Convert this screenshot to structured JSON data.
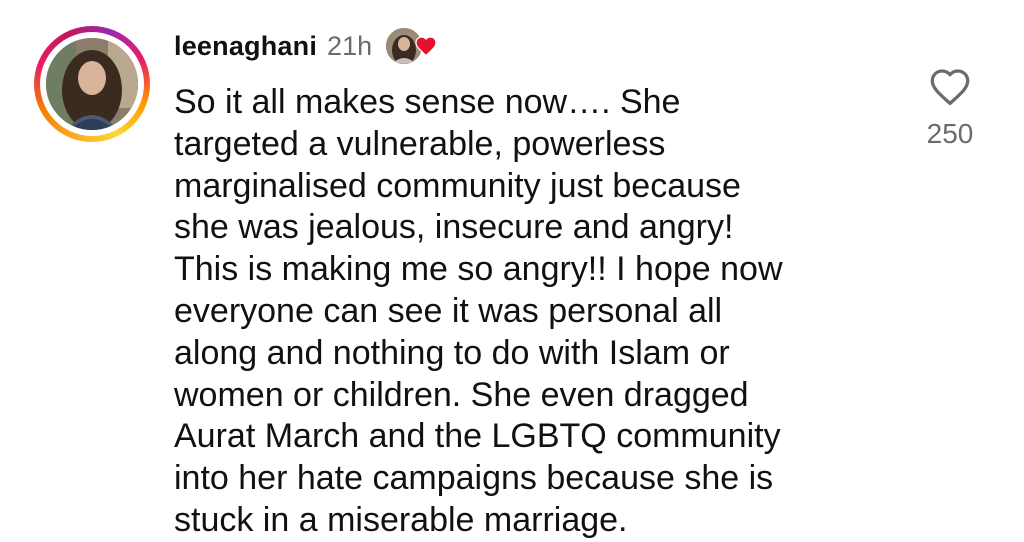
{
  "comment": {
    "username": "leenaghani",
    "timestamp": "21h",
    "text": "So it all makes sense now…. She\ntargeted a vulnerable, powerless\nmarginalised community just because\nshe was jealous, insecure and angry!\nThis is making me so angry!! I hope now\neveryone can see it was personal all\nalong and nothing to do with Islam or\nwomen or children. She even dragged\nAurat March and the LGBTQ community\ninto her hate campaigns because she is\nstuck in a miserable marriage.",
    "like_count": "250",
    "liked_by_creator": true
  },
  "icons": {
    "like": "heart-outline-icon",
    "creator_like": "red-heart-icon"
  },
  "colors": {
    "heart_red": "#e8112d",
    "muted_text": "#6b6b6b",
    "story_ring": [
      "#f9a825",
      "#e91e63",
      "#9c27b0"
    ]
  }
}
